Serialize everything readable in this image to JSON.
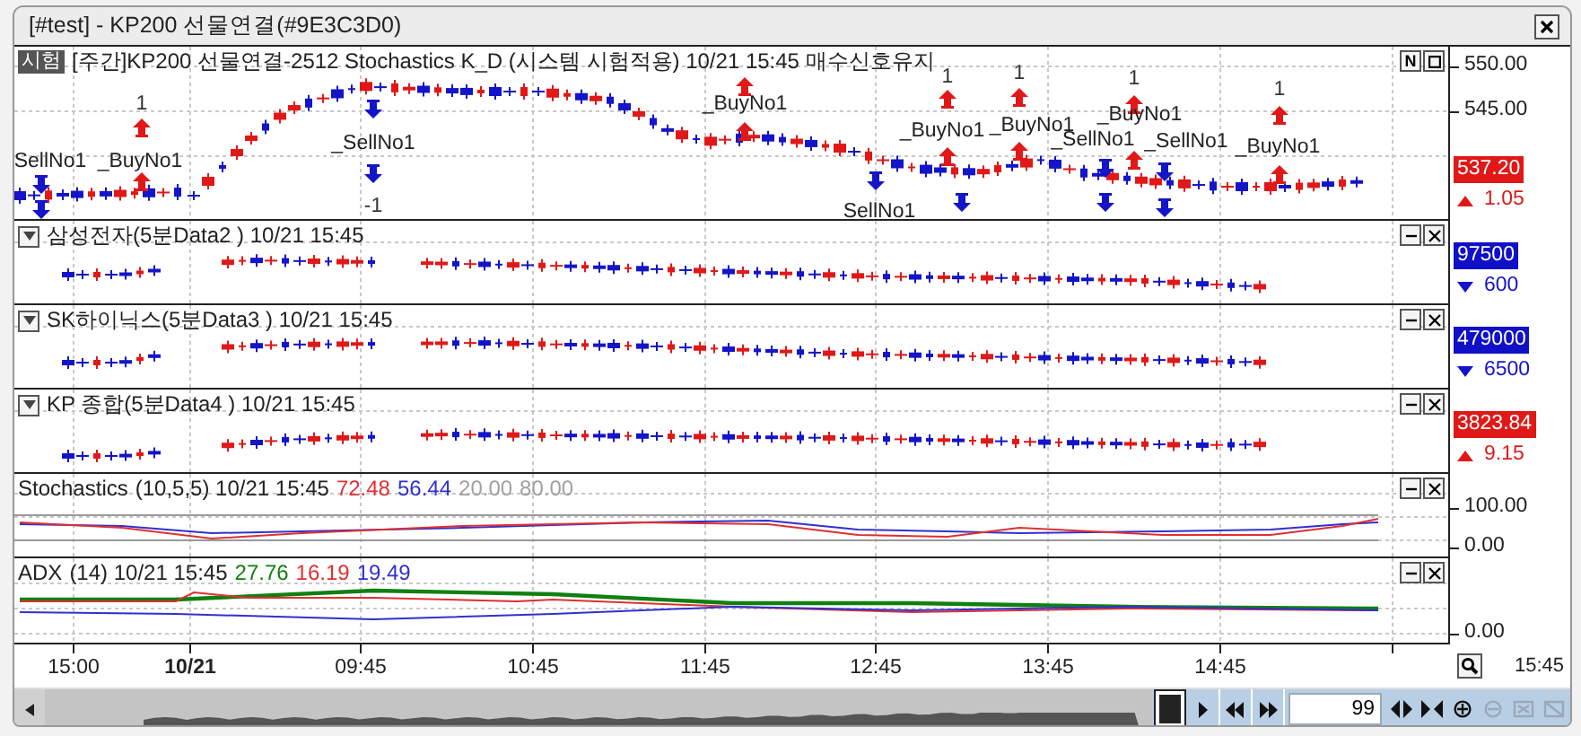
{
  "window": {
    "title": "[#test] - KP200 선물연결(#9E3C3D0)"
  },
  "main_pane": {
    "badge": "시험",
    "header": "[주간]KP200 선물연결-2512 Stochastics K_D (시스템 시험적용) 10/21 15:45 매수신호유지",
    "button": "N",
    "axis_ticks": [
      "550.00",
      "545.00"
    ],
    "price_tag": {
      "text": "537.20",
      "color": "#e01818"
    },
    "change": {
      "text": "1.05",
      "rising": true
    },
    "signals": [
      {
        "kind": "sell",
        "label": "SellNo1"
      },
      {
        "kind": "buy",
        "label": "_BuyNo1",
        "count": "1"
      },
      {
        "kind": "sell",
        "label": "_SellNo1",
        "count": "-1"
      },
      {
        "kind": "buy",
        "label": "_BuyNo1"
      },
      {
        "kind": "sell",
        "label": "SellNo1"
      },
      {
        "kind": "buy",
        "label": "_BuyNo1",
        "count": "1"
      },
      {
        "kind": "buy",
        "label": "_BuyNo1",
        "count": "1"
      },
      {
        "kind": "sell",
        "label": "_SellNo1"
      },
      {
        "kind": "buy",
        "label": "_BuyNo1",
        "count": "1"
      },
      {
        "kind": "sell",
        "label": "_SellNo1"
      },
      {
        "kind": "buy",
        "label": "_BuyNo1",
        "count": "1"
      }
    ]
  },
  "sub_panes": [
    {
      "title": "삼성전자(5분Data2 ) 10/21 15:45",
      "price_tag": {
        "text": "97500",
        "color": "#1010c8"
      },
      "change": {
        "text": "600",
        "rising": false
      }
    },
    {
      "title": "SK하이닉스(5분Data3 ) 10/21 15:45",
      "price_tag": {
        "text": "479000",
        "color": "#1010c8"
      },
      "change": {
        "text": "6500",
        "rising": false
      }
    },
    {
      "title": "KP 종합(5분Data4 ) 10/21 15:45",
      "price_tag": {
        "text": "3823.84",
        "color": "#e01818"
      },
      "change": {
        "text": "9.15",
        "rising": true
      }
    }
  ],
  "indicators": [
    {
      "name": "Stochastics",
      "params": "(10,5,5) 10/21 15:45",
      "values": [
        {
          "text": "72.48",
          "color": "#e03030"
        },
        {
          "text": "56.44",
          "color": "#3030d0"
        },
        {
          "text": "20.00",
          "color": "#a0a0a0"
        },
        {
          "text": "80.00",
          "color": "#a0a0a0"
        }
      ],
      "axis_ticks": [
        "100.00",
        "0.00"
      ]
    },
    {
      "name": "ADX",
      "params": "(14) 10/21 15:45",
      "values": [
        {
          "text": "27.76",
          "color": "#108010"
        },
        {
          "text": "16.19",
          "color": "#e03030"
        },
        {
          "text": "19.49",
          "color": "#3030d0"
        }
      ],
      "axis_ticks": [
        "0.00"
      ]
    }
  ],
  "time_axis": {
    "ticks": [
      {
        "label": "15:00",
        "bold": false
      },
      {
        "label": "10/21",
        "bold": true
      },
      {
        "label": "09:45",
        "bold": false
      },
      {
        "label": "10:45",
        "bold": false
      },
      {
        "label": "11:45",
        "bold": false
      },
      {
        "label": "12:45",
        "bold": false
      },
      {
        "label": "13:45",
        "bold": false
      },
      {
        "label": "14:45",
        "bold": false
      }
    ],
    "last": "15:45"
  },
  "toolbar": {
    "page_size": "99",
    "buttons": [
      {
        "kind": "stretch",
        "disabled": false
      },
      {
        "kind": "shrink",
        "disabled": false
      },
      {
        "kind": "zoom-in",
        "disabled": false
      },
      {
        "kind": "zoom-out",
        "disabled": true
      },
      {
        "kind": "fit",
        "disabled": true
      },
      {
        "kind": "reset",
        "disabled": true
      }
    ]
  }
}
